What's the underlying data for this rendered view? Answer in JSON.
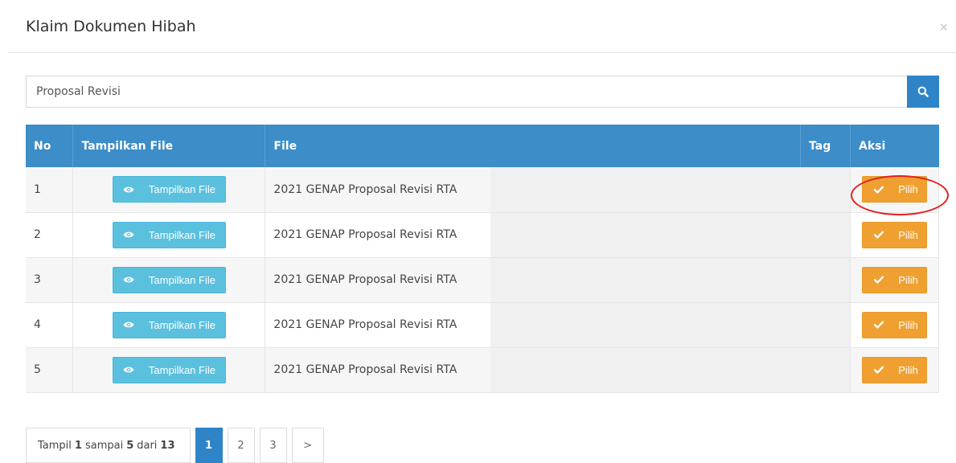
{
  "modal": {
    "title": "Klaim Dokumen Hibah",
    "close_label": "×"
  },
  "search": {
    "value": "Proposal Revisi",
    "icon": "search-icon"
  },
  "table": {
    "headers": [
      "No",
      "Tampilkan File",
      "File",
      "Tag",
      "Aksi"
    ],
    "rows": [
      {
        "no": "1",
        "view_label": "Tampilkan File",
        "file": "2021 GENAP Proposal Revisi RTA",
        "tag": "",
        "action_label": "Pilih"
      },
      {
        "no": "2",
        "view_label": "Tampilkan File",
        "file": "2021 GENAP Proposal Revisi RTA",
        "tag": "",
        "action_label": "Pilih"
      },
      {
        "no": "3",
        "view_label": "Tampilkan File",
        "file": "2021 GENAP Proposal Revisi RTA",
        "tag": "",
        "action_label": "Pilih"
      },
      {
        "no": "4",
        "view_label": "Tampilkan File",
        "file": "2021 GENAP Proposal Revisi RTA",
        "tag": "",
        "action_label": "Pilih"
      },
      {
        "no": "5",
        "view_label": "Tampilkan File",
        "file": "2021 GENAP Proposal Revisi RTA",
        "tag": "",
        "action_label": "Pilih"
      }
    ]
  },
  "pagination": {
    "info_prefix": "Tampil",
    "start": "1",
    "info_mid1": "sampai",
    "end": "5",
    "info_mid2": "dari",
    "total": "13",
    "pages": [
      "1",
      "2",
      "3"
    ],
    "active": "1",
    "next_label": ">"
  },
  "colors": {
    "primary": "#3c8dc8",
    "info_button": "#5bc0de",
    "warning_button": "#f0a030",
    "highlight": "#e02020"
  }
}
